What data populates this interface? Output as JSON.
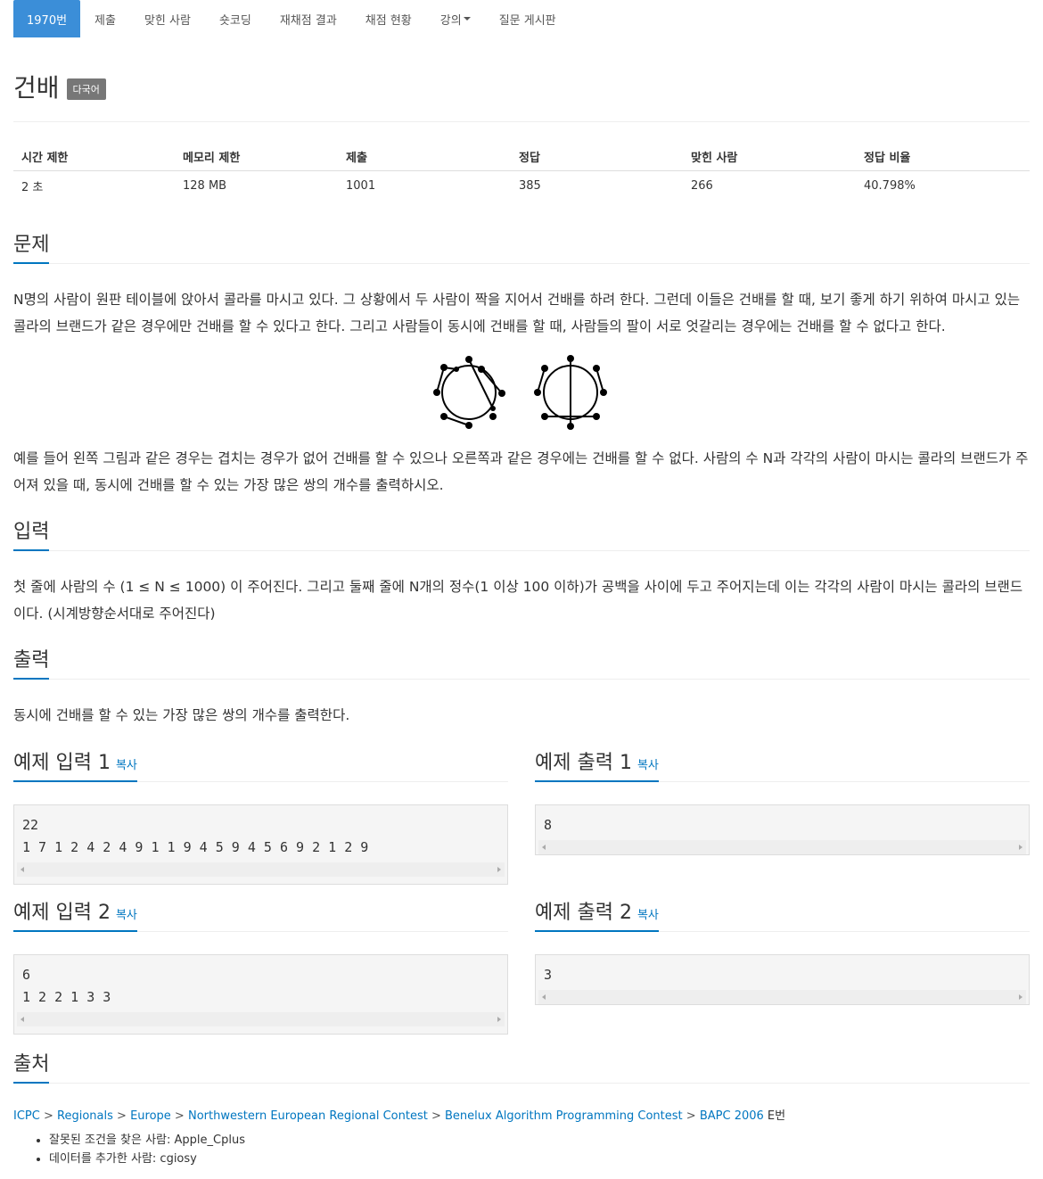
{
  "nav": {
    "items": [
      "1970번",
      "제출",
      "맞힌 사람",
      "숏코딩",
      "재채점 결과",
      "채점 현황",
      "강의",
      "질문 게시판"
    ]
  },
  "problem": {
    "title": "건배",
    "lang_badge": "다국어"
  },
  "stats": {
    "headers": [
      "시간 제한",
      "메모리 제한",
      "제출",
      "정답",
      "맞힌 사람",
      "정답 비율"
    ],
    "values": [
      "2 초",
      "128 MB",
      "1001",
      "385",
      "266",
      "40.798%"
    ]
  },
  "sections": {
    "problem": "문제",
    "input": "입력",
    "output": "출력",
    "source": "출처"
  },
  "text": {
    "problem_p1": "N명의 사람이 원판 테이블에 앉아서 콜라를 마시고 있다. 그 상황에서 두 사람이 짝을 지어서 건배를 하려 한다. 그런데 이들은 건배를 할 때, 보기 좋게 하기 위하여 마시고 있는 콜라의 브랜드가 같은 경우에만 건배를 할 수 있다고 한다. 그리고 사람들이 동시에 건배를 할 때, 사람들의 팔이 서로 엇갈리는 경우에는 건배를 할 수 없다고 한다.",
    "problem_p2": "예를 들어 왼쪽 그림과 같은 경우는 겹치는 경우가 없어 건배를 할 수 있으나 오른쪽과 같은 경우에는 건배를 할 수 없다. 사람의 수 N과 각각의 사람이 마시는 콜라의 브랜드가 주어져 있을 때, 동시에 건배를 할 수 있는 가장 많은 쌍의 개수를 출력하시오.",
    "input": "첫 줄에 사람의 수 (1 ≤ N ≤ 1000) 이 주어진다. 그리고 둘째 줄에 N개의 정수(1 이상 100 이하)가 공백을 사이에 두고 주어지는데 이는 각각의 사람이 마시는 콜라의 브랜드이다. (시계방향순서대로 주어진다)",
    "output": "동시에 건배를 할 수 있는 가장 많은 쌍의 개수를 출력한다."
  },
  "samples": {
    "in1_title": "예제 입력 1",
    "out1_title": "예제 출력 1",
    "in2_title": "예제 입력 2",
    "out2_title": "예제 출력 2",
    "copy": "복사",
    "in1": "22\n1 7 1 2 4 2 4 9 1 1 9 4 5 9 4 5 6 9 2 1 2 9",
    "out1": "8",
    "in2": "6\n1 2 2 1 3 3",
    "out2": "3"
  },
  "source": {
    "links": [
      "ICPC",
      "Regionals",
      "Europe",
      "Northwestern European Regional Contest",
      "Benelux Algorithm Programming Contest",
      "BAPC 2006"
    ],
    "suffix": "E번",
    "sep": ">",
    "credits": [
      "잘못된 조건을 찾은 사람: Apple_Cplus",
      "데이터를 추가한 사람: cgiosy"
    ]
  }
}
